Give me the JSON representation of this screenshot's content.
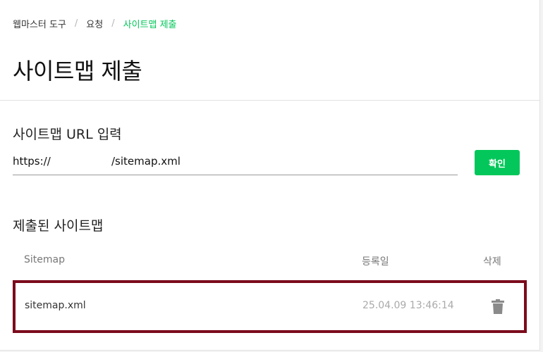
{
  "breadcrumb": {
    "items": [
      "웹마스터 도구",
      "요청"
    ],
    "current": "사이트맵 제출",
    "separator": "/"
  },
  "page_title": "사이트맵 제출",
  "url_section": {
    "title": "사이트맵 URL 입력",
    "prefix": "https://",
    "suffix": "/sitemap.xml",
    "confirm_label": "확인"
  },
  "submitted_section": {
    "title": "제출된 사이트맵",
    "columns": {
      "sitemap": "Sitemap",
      "date": "등록일",
      "delete": "삭제"
    },
    "rows": [
      {
        "name": "sitemap.xml",
        "date": "25.04.09 13:46:14"
      }
    ]
  },
  "icons": {
    "delete": "trash-icon"
  },
  "colors": {
    "accent": "#03c75a",
    "highlight_border": "#7b0b1c"
  }
}
